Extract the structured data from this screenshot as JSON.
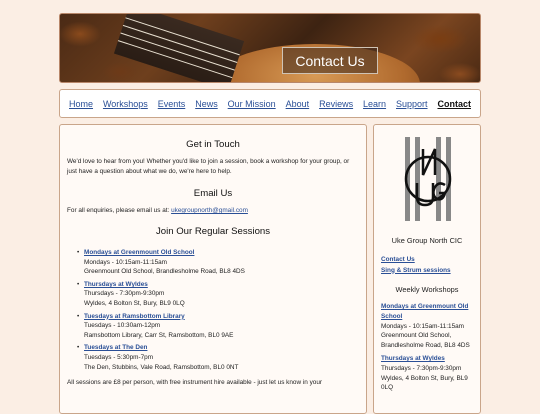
{
  "banner": {
    "title": "Contact Us"
  },
  "nav": {
    "items": [
      {
        "label": "Home"
      },
      {
        "label": "Workshops"
      },
      {
        "label": "Events"
      },
      {
        "label": "News"
      },
      {
        "label": "Our Mission"
      },
      {
        "label": "About"
      },
      {
        "label": "Reviews"
      },
      {
        "label": "Learn"
      },
      {
        "label": "Support"
      },
      {
        "label": "Contact"
      }
    ]
  },
  "main": {
    "get_in_touch": {
      "heading": "Get in Touch",
      "text": "We'd love to hear from you! Whether you'd like to join a session, book a workshop for your group, or just have a question about what we do, we're here to help."
    },
    "email": {
      "heading": "Email Us",
      "prefix": "For all enquiries, please email us at: ",
      "address": "ukegroupnorth@gmail.com"
    },
    "sessions": {
      "heading": "Join Our Regular Sessions",
      "items": [
        {
          "title": "Mondays at Greenmount Old School",
          "time": "Mondays - 10:15am-11:15am",
          "place": "Greenmount Old School, Brandlesholme Road, BL8 4DS"
        },
        {
          "title": "Thursdays at Wyldes",
          "time": "Thursdays - 7:30pm-9:30pm",
          "place": "Wyldes, 4 Bolton St, Bury, BL9 0LQ"
        },
        {
          "title": "Tuesdays at Ramsbottom Library",
          "time": "Tuesdays - 10:30am-12pm",
          "place": "Ramsbottom Library, Carr St, Ramsbottom, BL0 9AE"
        },
        {
          "title": "Tuesdays at The Den",
          "time": "Tuesdays - 5:30pm-7pm",
          "place": "The Den, Stubbins, Vale Road, Ramsbottom, BL0 0NT"
        }
      ],
      "footer": "All sessions are £8 per person, with free instrument hire available - just let us know in your"
    }
  },
  "sidebar": {
    "org_name": "Uke Group North CIC",
    "links": [
      {
        "label": "Contact Us"
      },
      {
        "label": "Sing & Strum sessions"
      }
    ],
    "workshops_heading": "Weekly Workshops",
    "workshops": [
      {
        "title": "Mondays at Greenmount Old School",
        "time": "Mondays - 10:15am-11:15am",
        "place": "Greenmount Old School, Brandlesholme Road, BL8 4DS"
      },
      {
        "title": "Thursdays at Wyldes",
        "time": "Thursdays - 7:30pm-9:30pm",
        "place": "Wyldes, 4 Bolton St, Bury, BL9 0LQ"
      }
    ]
  }
}
